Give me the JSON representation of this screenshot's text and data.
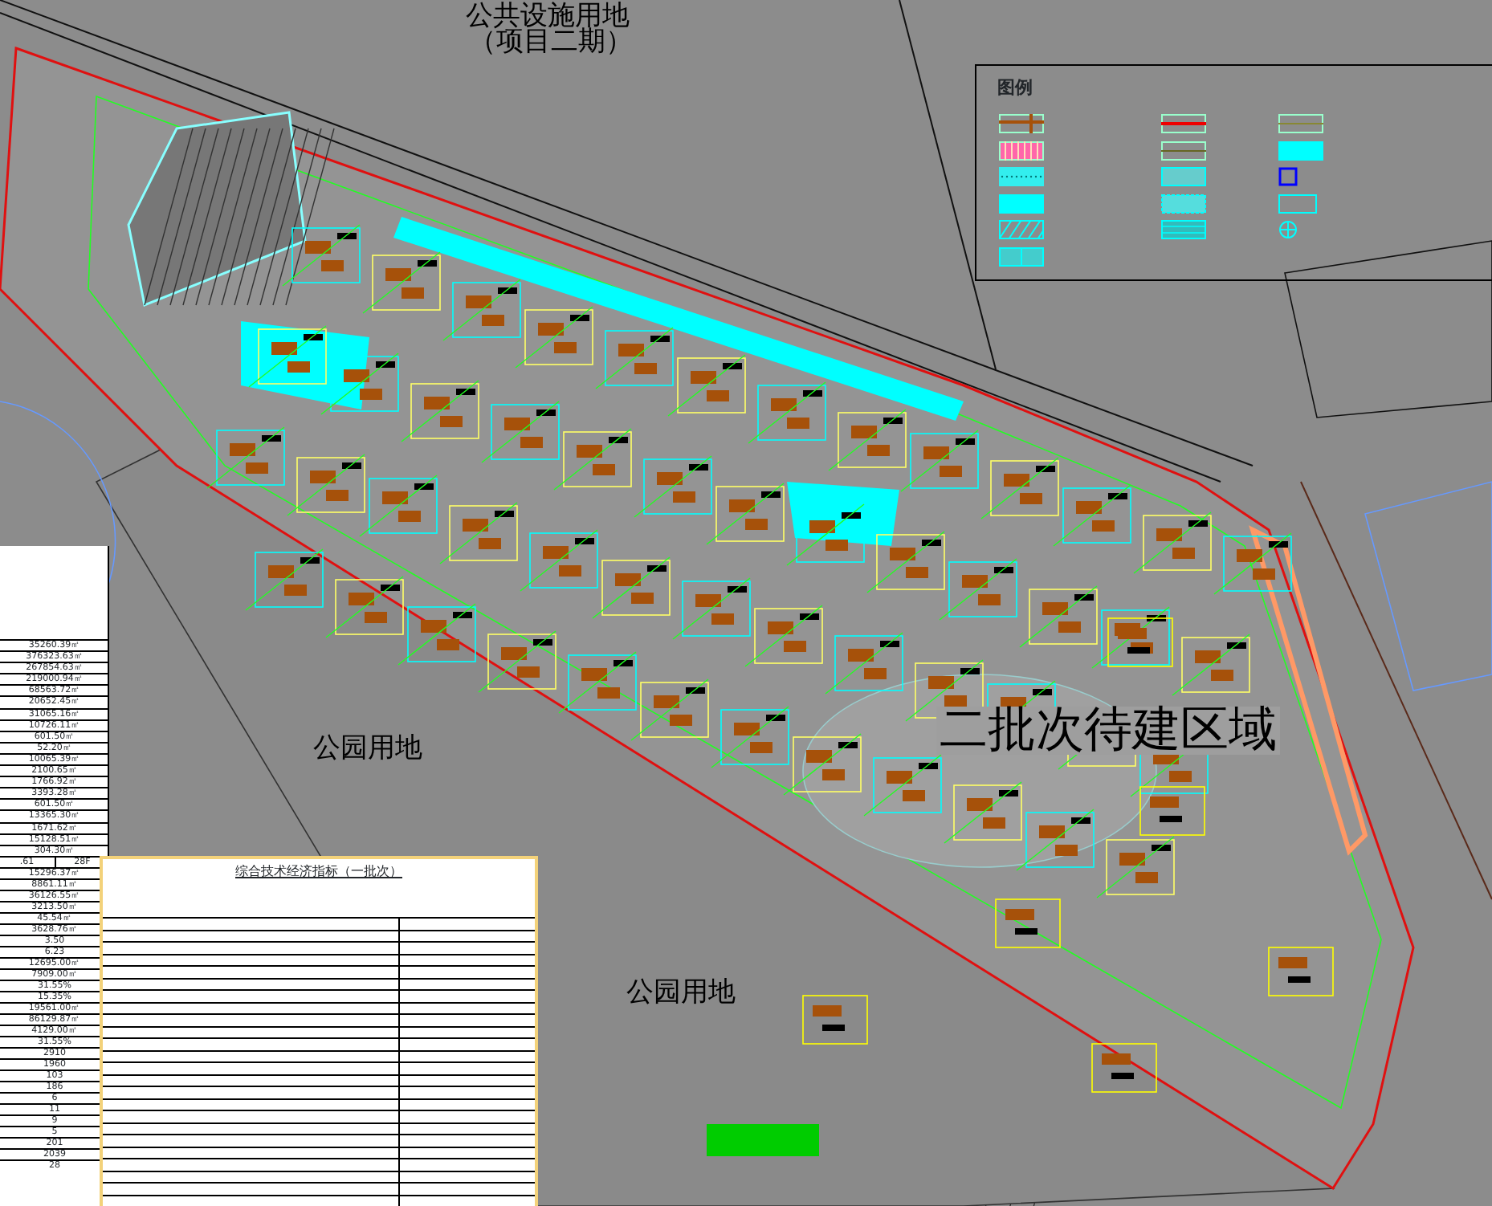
{
  "drawing_labels": [
    {
      "kind": "title",
      "text": "公共设施用地"
    },
    {
      "kind": "subtitle",
      "text": "（项目二期）"
    },
    {
      "kind": "park",
      "text": "公园用地"
    },
    {
      "kind": "zone",
      "text": "二批次待建区域"
    },
    {
      "kind": "park2",
      "text": "公园用地"
    }
  ],
  "legend": {
    "title": "图例",
    "swatches": [
      {
        "kind": "road"
      },
      {
        "kind": "grid"
      },
      {
        "kind": "dots"
      },
      {
        "kind": "fill"
      },
      {
        "kind": "hatch"
      },
      {
        "kind": "tiles"
      },
      {
        "kind": "redline"
      },
      {
        "kind": "oliveline"
      },
      {
        "kind": "dotted"
      },
      {
        "kind": "speckle"
      },
      {
        "kind": "mesh"
      },
      {
        "kind": "thinline"
      },
      {
        "kind": "solid"
      },
      {
        "kind": "square"
      },
      {
        "kind": "outline"
      },
      {
        "kind": "crosshair"
      }
    ]
  },
  "left_table": {
    "rows": [
      [
        "35260.39㎡"
      ],
      [
        "376323.63㎡"
      ],
      [
        "267854.63㎡"
      ],
      [
        "219000.94㎡"
      ],
      [
        "68563.72㎡"
      ],
      [
        "20652.45㎡"
      ],
      [
        "31065.16㎡"
      ],
      [
        "10726.11㎡"
      ],
      [
        "601.50㎡"
      ],
      [
        "52.20㎡"
      ],
      [
        "10065.39㎡"
      ],
      [
        "2100.65㎡"
      ],
      [
        "1766.92㎡"
      ],
      [
        "3393.28㎡"
      ],
      [
        "601.50㎡"
      ],
      [
        "13365.30㎡"
      ],
      [
        "1671.62㎡"
      ],
      [
        "15128.51㎡"
      ],
      [
        "304.30㎡"
      ],
      [
        ".61",
        "28F"
      ],
      [
        "15296.37㎡"
      ],
      [
        "8861.11㎡"
      ],
      [
        "36126.55㎡"
      ],
      [
        "3213.50㎡"
      ],
      [
        "45.54㎡"
      ],
      [
        "3628.76㎡"
      ],
      [
        "3.50"
      ],
      [
        "6.23"
      ],
      [
        "12695.00㎡"
      ],
      [
        "7909.00㎡"
      ],
      [
        "31.55%"
      ],
      [
        "15.35%"
      ],
      [
        "19561.00㎡"
      ],
      [
        "86129.87㎡"
      ],
      [
        "4129.00㎡"
      ],
      [
        "31.55%"
      ],
      [
        "2910"
      ],
      [
        "1960"
      ],
      [
        "103"
      ],
      [
        "186"
      ],
      [
        "6"
      ],
      [
        "11"
      ],
      [
        "9"
      ],
      [
        "5"
      ],
      [
        "201"
      ],
      [
        "2039"
      ],
      [
        "28"
      ]
    ]
  },
  "summary_table": {
    "title": "综合技术经济指标（一批次）"
  }
}
